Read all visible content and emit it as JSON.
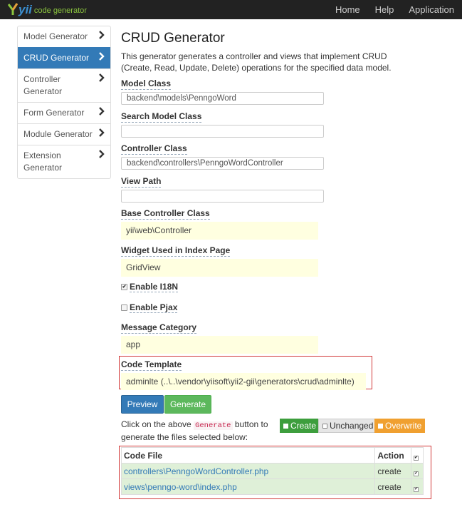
{
  "brand": {
    "logo_text": "yii",
    "subtitle": "code generator"
  },
  "nav": [
    "Home",
    "Help",
    "Application"
  ],
  "sidebar": [
    {
      "label": "Model Generator",
      "active": false
    },
    {
      "label": "CRUD Generator",
      "active": true
    },
    {
      "label": "Controller Generator",
      "active": false
    },
    {
      "label": "Form Generator",
      "active": false
    },
    {
      "label": "Module Generator",
      "active": false
    },
    {
      "label": "Extension Generator",
      "active": false
    }
  ],
  "main": {
    "title": "CRUD Generator",
    "description": "This generator generates a controller and views that implement CRUD (Create, Read, Update, Delete) operations for the specified data model."
  },
  "form": {
    "model_class": {
      "label": "Model Class",
      "value": "backend\\models\\PenngoWord"
    },
    "search_model_class": {
      "label": "Search Model Class",
      "value": ""
    },
    "controller_class": {
      "label": "Controller Class",
      "value": "backend\\controllers\\PenngoWordController"
    },
    "view_path": {
      "label": "View Path",
      "value": ""
    },
    "base_controller_class": {
      "label": "Base Controller Class",
      "value": "yii\\web\\Controller"
    },
    "widget_index": {
      "label": "Widget Used in Index Page",
      "value": "GridView"
    },
    "enable_i18n": {
      "label": "Enable I18N",
      "checked": true
    },
    "enable_pjax": {
      "label": "Enable Pjax",
      "checked": false
    },
    "message_category": {
      "label": "Message Category",
      "value": "app"
    },
    "code_template": {
      "label": "Code Template",
      "value": "adminlte (..\\..\\vendor\\yiisoft\\yii2-gii\\generators\\crud\\adminlte)"
    }
  },
  "buttons": {
    "preview": "Preview",
    "generate": "Generate"
  },
  "instructions": {
    "before": "Click on the above",
    "code": "Generate",
    "after": "button to generate the files selected below:"
  },
  "legend": {
    "create": "Create",
    "unchanged": "Unchanged",
    "overwrite": "Overwrite"
  },
  "files_table": {
    "headers": {
      "file": "Code File",
      "action": "Action"
    },
    "rows": [
      {
        "file": "controllers\\PenngoWordController.php",
        "action": "create",
        "checked": true
      },
      {
        "file": "views\\penngo-word\\index.php",
        "action": "create",
        "checked": true
      }
    ]
  },
  "colors": {
    "primary": "#337ab7",
    "success": "#5cb85c",
    "create": "#3d9e3d",
    "overwrite": "#f0a030",
    "unchanged": "#ddd",
    "highlight_border": "#d23a3a"
  }
}
